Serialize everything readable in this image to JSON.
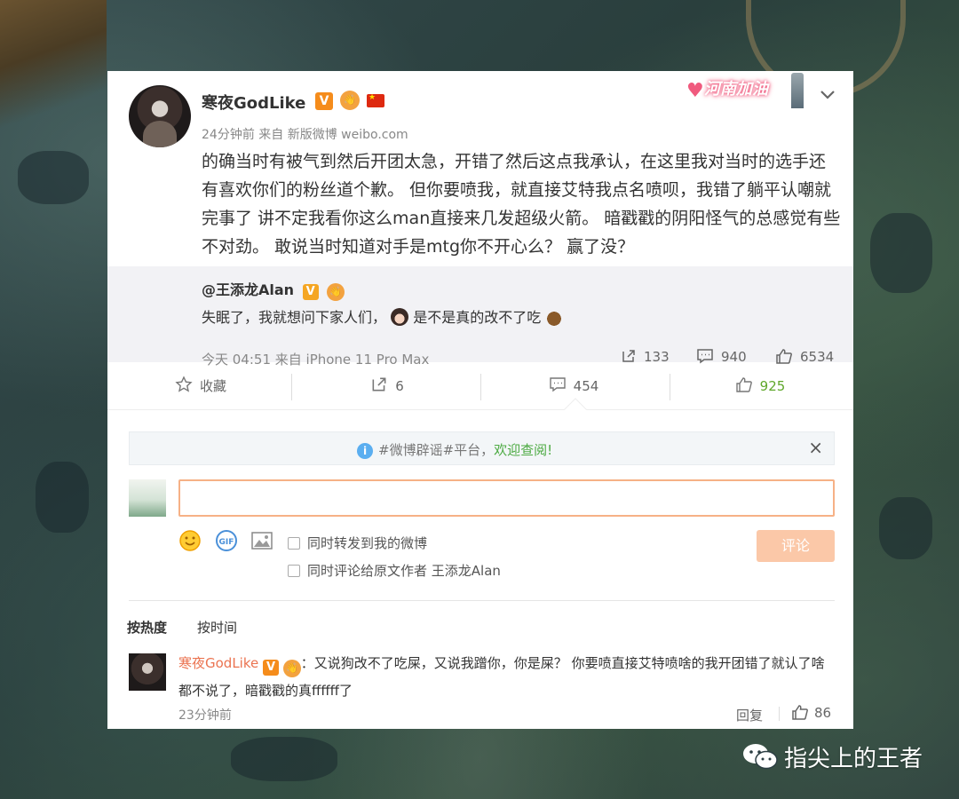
{
  "post": {
    "username": "寒夜GodLike",
    "badges": {
      "verified": "V",
      "hand": "👋"
    },
    "meta": "24分钟前 来自 新版微博 weibo.com",
    "promo_text": "河南加油",
    "text": "的确当时有被气到然后开团太急，开错了然后这点我承认，在这里我对当时的选手还有喜欢你们的粉丝道个歉。 但你要喷我，就直接艾特我点名喷呗，我错了躺平认嘲就完事了 讲不定我看你这么man直接来几发超级火箭。 暗戳戳的阴阳怪气的总感觉有些不对劲。 敢说当时知道对手是mtg你不开心么？ 赢了没？"
  },
  "repost": {
    "user": "@王添龙Alan",
    "text_a": "失眠了，我就想问下家人们，",
    "text_b": "是不是真的改不了吃",
    "meta": "今天 04:51 来自 iPhone 11 Pro Max",
    "reposts": "133",
    "comments": "940",
    "likes": "6534"
  },
  "actions": {
    "favorite": "收藏",
    "forward": "6",
    "comment": "454",
    "like": "925"
  },
  "notice": {
    "text": "#微博辟谣#平台，",
    "link": "欢迎查阅!",
    "close": "×"
  },
  "composer": {
    "placeholder": "",
    "check_forward": "同时转发到我的微博",
    "check_comment": "同时评论给原文作者 王添龙Alan",
    "submit": "评论"
  },
  "comments": {
    "sort_hot": "按热度",
    "sort_time": "按时间",
    "items": [
      {
        "user": "寒夜GodLike",
        "text": "：又说狗改不了吃屎，又说我蹭你，你是屎？ 你要喷直接艾特喷啥的我开团错了就认了啥都不说了，暗戳戳的真ffffff了",
        "time": "23分钟前",
        "reply": "回复",
        "likes": "86"
      }
    ]
  },
  "watermark": {
    "text": "指尖上的王者"
  },
  "colors": {
    "accent_orange": "#eb7350",
    "like_green": "#5fa72b",
    "submit_disabled": "#fbc8a8",
    "input_border": "#f6b186"
  },
  "icons": [
    "chevron-down-icon",
    "star-icon",
    "forward-icon",
    "comment-icon",
    "thumbs-up-icon",
    "info-icon",
    "close-icon",
    "smile-icon",
    "gif-icon",
    "image-icon",
    "wechat-icon"
  ]
}
